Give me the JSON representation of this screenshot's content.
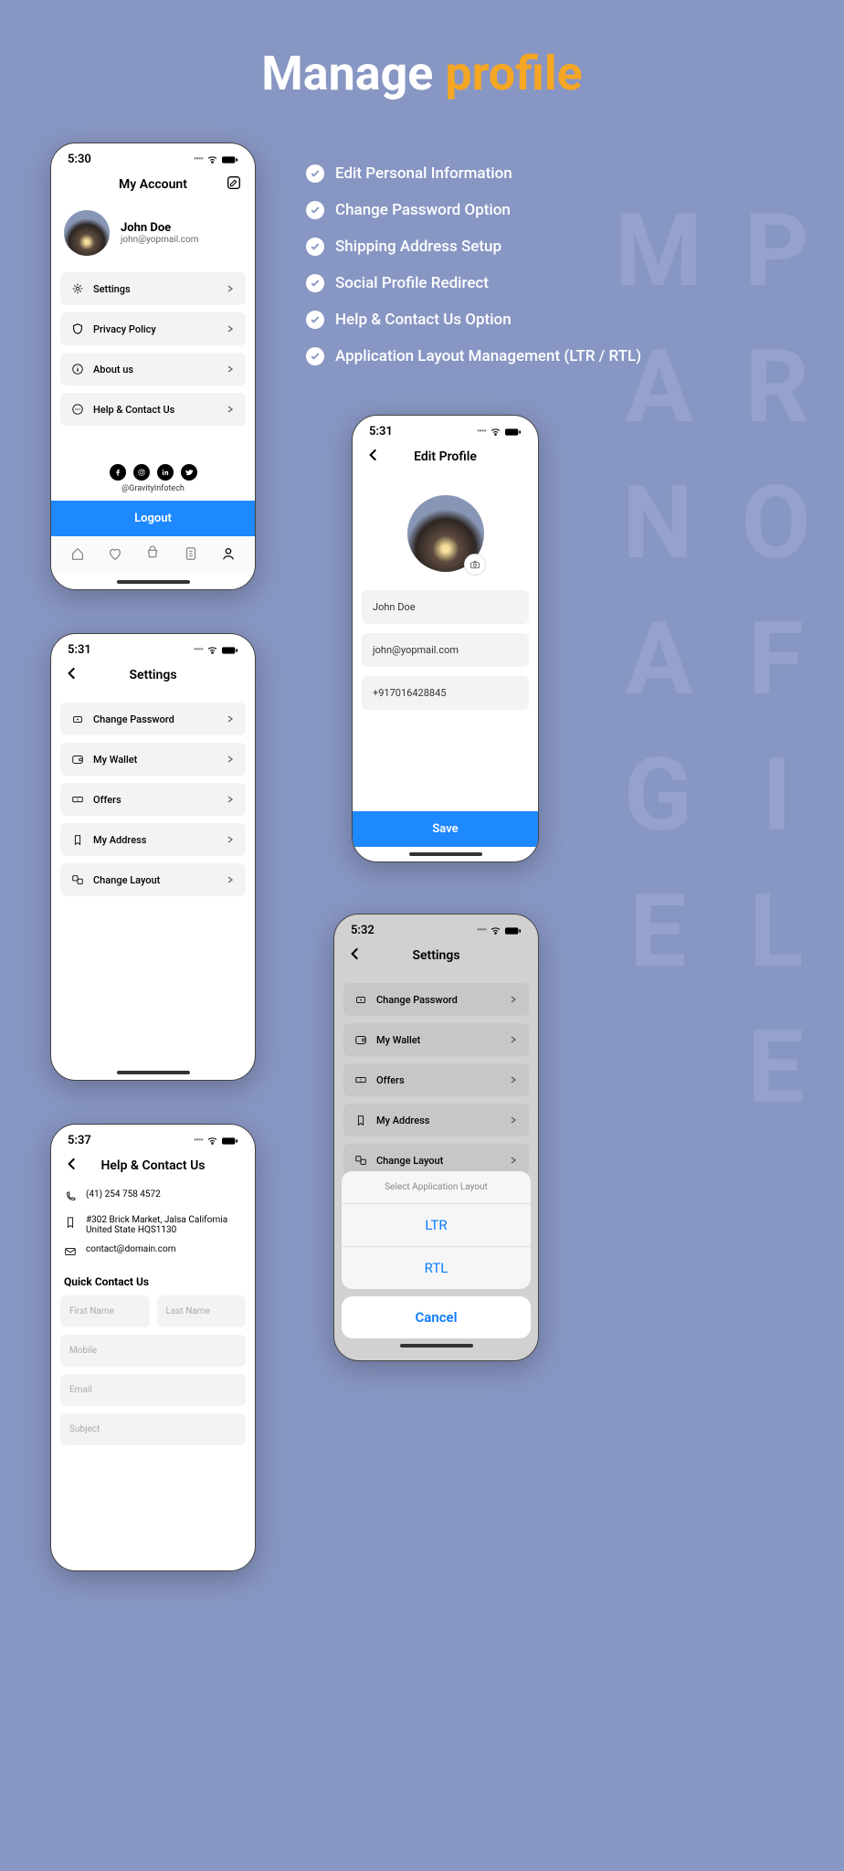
{
  "title": {
    "word1": "Manage",
    "word2": "profile"
  },
  "vertical": "MANAGE PROFILE",
  "features": [
    "Edit Personal Information",
    "Change Password Option",
    "Shipping Address Setup",
    "Social Profile Redirect",
    "Help & Contact Us Option",
    "Application Layout Management (LTR / RTL)"
  ],
  "phone1": {
    "time": "5:30",
    "title": "My Account",
    "user_name": "John Doe",
    "user_email": "john@yopmail.com",
    "menu": [
      "Settings",
      "Privacy Policy",
      "About us",
      "Help & Contact Us"
    ],
    "handle": "@GravityInfotech",
    "logout": "Logout"
  },
  "phone2": {
    "time": "5:31",
    "title": "Edit Profile",
    "fields": {
      "name": "John Doe",
      "email": "john@yopmail.com",
      "phone": "+917016428845"
    },
    "save": "Save"
  },
  "phone3": {
    "time": "5:31",
    "title": "Settings",
    "menu": [
      "Change Password",
      "My Wallet",
      "Offers",
      "My Address",
      "Change Layout"
    ]
  },
  "phone4": {
    "time": "5:32",
    "title": "Settings",
    "menu": [
      "Change Password",
      "My Wallet",
      "Offers",
      "My Address",
      "Change Layout"
    ],
    "sheet": {
      "title": "Select Application Layout",
      "opt1": "LTR",
      "opt2": "RTL",
      "cancel": "Cancel"
    }
  },
  "phone5": {
    "time": "5:37",
    "title": "Help & Contact Us",
    "phone": "(41) 254 758 4572",
    "address": "#302 Brick Market, Jalsa California United State HQS1130",
    "email": "contact@domain.com",
    "quick_title": "Quick Contact Us",
    "placeholders": {
      "fname": "First Name",
      "lname": "Last Name",
      "mobile": "Mobile",
      "email": "Email",
      "subject": "Subject"
    }
  }
}
